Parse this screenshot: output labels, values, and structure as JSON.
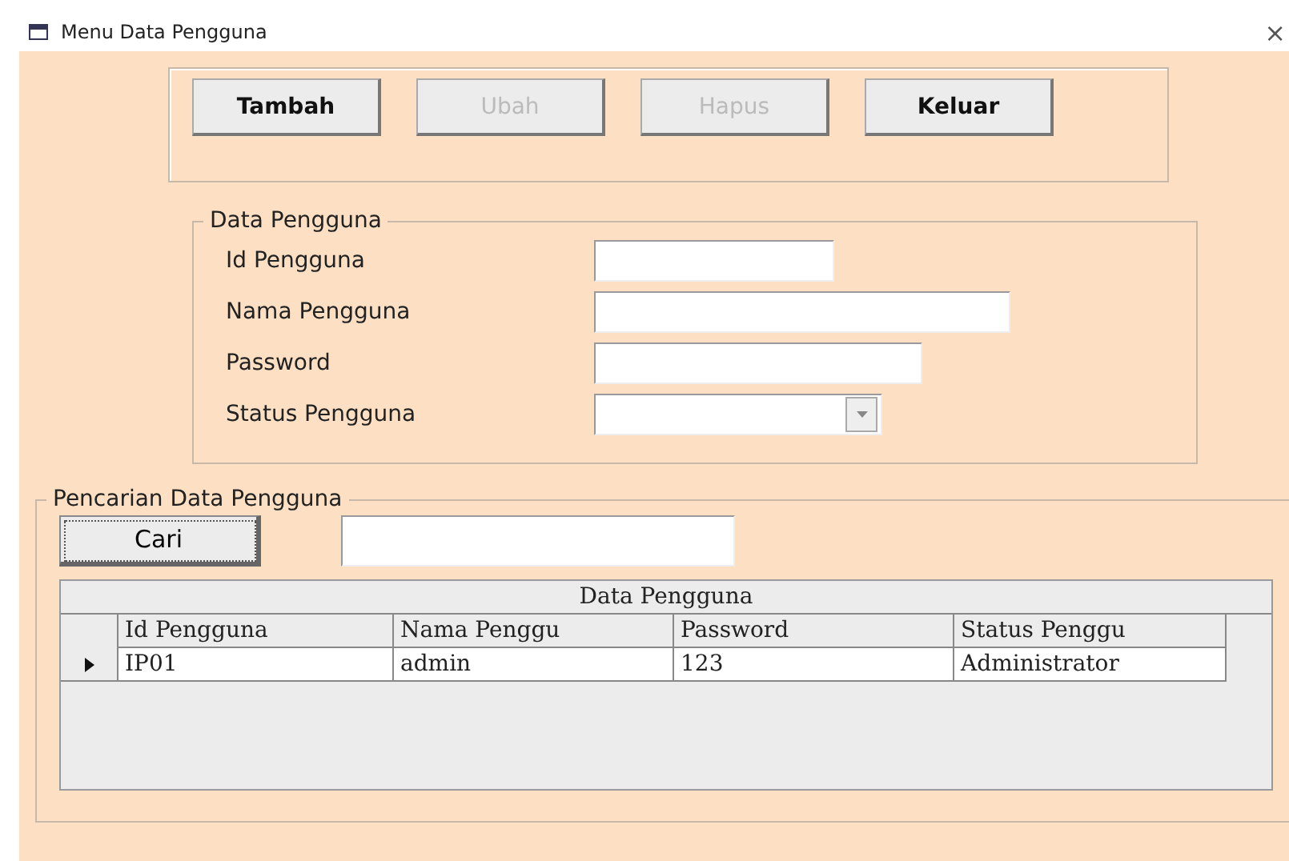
{
  "window": {
    "title": "Menu Data Pengguna",
    "close": "×"
  },
  "buttons": [
    {
      "label": "Tambah",
      "disabled": false
    },
    {
      "label": "Ubah",
      "disabled": true
    },
    {
      "label": "Hapus",
      "disabled": true
    },
    {
      "label": "Keluar",
      "disabled": false
    }
  ],
  "user_data": {
    "title": "Data Pengguna",
    "fields": [
      {
        "label": "Id Pengguna",
        "kind": "text"
      },
      {
        "label": "Nama Pengguna",
        "kind": "text"
      },
      {
        "label": "Password",
        "kind": "text"
      },
      {
        "label": "Status Pengguna",
        "kind": "dropdown"
      }
    ]
  },
  "search": {
    "title": "Pencarian Data Pengguna",
    "button": "Cari"
  },
  "table": {
    "caption": "Data Pengguna",
    "columns": [
      "Id Pengguna",
      "Nama Penggu",
      "Password",
      "Status Penggu"
    ],
    "rows": [
      {
        "selected": true,
        "cells": [
          "IP01",
          "admin",
          "123",
          "Administrator"
        ]
      }
    ]
  }
}
